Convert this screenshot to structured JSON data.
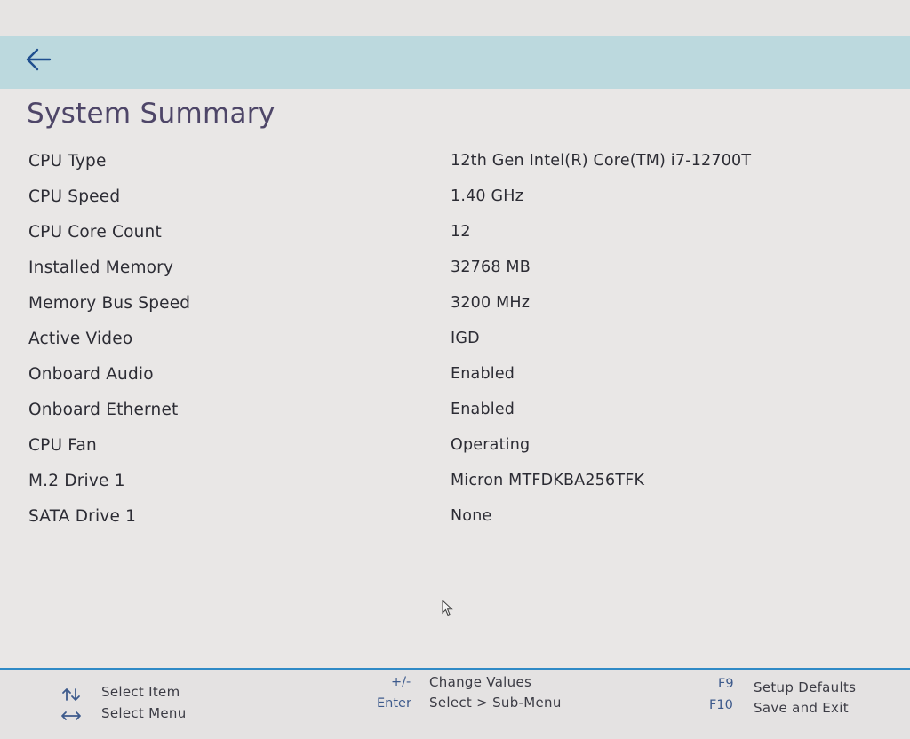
{
  "header": {
    "back_icon": "arrow-left-icon",
    "accent_color": "#bcd9de"
  },
  "page": {
    "title": "System Summary"
  },
  "summary": [
    {
      "label": "CPU Type",
      "value": "12th Gen Intel(R) Core(TM) i7-12700T"
    },
    {
      "label": "CPU Speed",
      "value": "1.40 GHz"
    },
    {
      "label": "CPU Core Count",
      "value": "12"
    },
    {
      "label": "Installed Memory",
      "value": "32768 MB"
    },
    {
      "label": "Memory Bus Speed",
      "value": "3200 MHz"
    },
    {
      "label": "Active Video",
      "value": "IGD"
    },
    {
      "label": "Onboard Audio",
      "value": "Enabled"
    },
    {
      "label": "Onboard Ethernet",
      "value": "Enabled"
    },
    {
      "label": "CPU Fan",
      "value": "Operating"
    },
    {
      "label": "M.2 Drive 1",
      "value": "Micron MTFDKBA256TFK"
    },
    {
      "label": "SATA Drive 1",
      "value": "None"
    }
  ],
  "footer": {
    "line_color": "#2f8ac6",
    "select_item": {
      "icon": "up-down-arrows-icon",
      "label": "Select Item"
    },
    "select_menu": {
      "icon": "left-right-arrows-icon",
      "label": "Select Menu"
    },
    "change_values": {
      "key": "+/-",
      "label": "Change Values"
    },
    "sub_menu": {
      "key": "Enter",
      "label": "Select > Sub-Menu"
    },
    "setup_defaults": {
      "key": "F9",
      "label": "Setup Defaults"
    },
    "save_exit": {
      "key": "F10",
      "label": "Save and Exit"
    }
  }
}
